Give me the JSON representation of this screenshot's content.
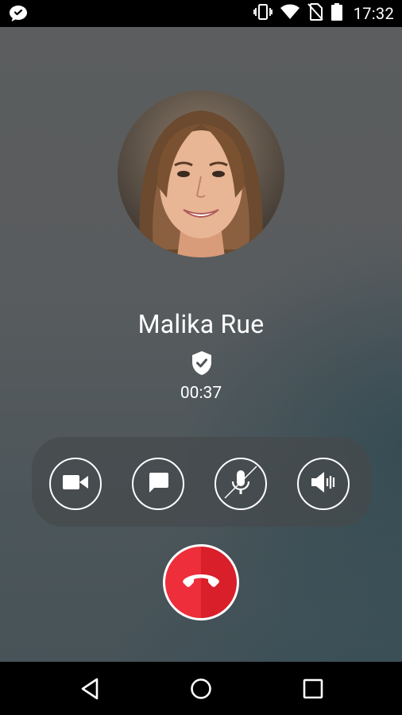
{
  "status_bar": {
    "time": "17:32",
    "icons": [
      "chat-app-icon",
      "vibrate-icon",
      "wifi-icon",
      "no-sim-icon",
      "battery-icon"
    ]
  },
  "call": {
    "contact_name": "Malika Rue",
    "duration": "00:37",
    "verified_icon": "shield-check-icon"
  },
  "controls": [
    {
      "name": "video",
      "icon": "video-camera-icon"
    },
    {
      "name": "message",
      "icon": "chat-bubble-icon"
    },
    {
      "name": "mute",
      "icon": "microphone-muted-icon"
    },
    {
      "name": "speaker",
      "icon": "speaker-icon"
    }
  ],
  "end_call": {
    "icon": "hang-up-icon",
    "color": "#ee2e3b"
  },
  "nav_bar": {
    "buttons": [
      "back-icon",
      "home-icon",
      "recents-icon"
    ]
  }
}
